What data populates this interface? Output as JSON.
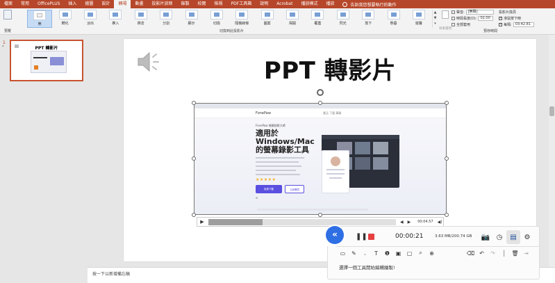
{
  "menu": {
    "tabs": [
      "檔案",
      "常用",
      "OfficePLUS",
      "插入",
      "繪圖",
      "設計",
      "轉場",
      "動畫",
      "投影片放映",
      "錄製",
      "校閱",
      "檢視",
      "PDF工具箱",
      "說明",
      "Acrobat",
      "播放模式",
      "播放"
    ],
    "active_index": 6,
    "tell_me": "告訴我您想要執行的動作"
  },
  "ribbon": {
    "preview_label": "預覽",
    "transitions_group_label": "切換到此投影片",
    "transitions": [
      "無",
      "轉化",
      "淡出",
      "推入",
      "擦去",
      "分割",
      "顯示",
      "切換",
      "隨機線條",
      "圖案",
      "揭開",
      "覆蓋",
      "閃光",
      "落下",
      "懸垂",
      "窗簾",
      "吹動"
    ],
    "selected_transition_index": 0,
    "effect_options_label": "效果選項",
    "timing": {
      "group_label": "預存時間",
      "sound_label": "聲音:",
      "sound_value": "[無聲]",
      "duration_label": "時間長度(D):",
      "duration_value": "02.00",
      "apply_all_label": "全部套用",
      "advance_label": "投影片換頁",
      "on_click_label": "滑鼠按下時",
      "after_label": "每隔:",
      "after_value": "03:42.81"
    }
  },
  "thumbs": {
    "number": "1",
    "star": "*",
    "title": "PPT 轉影片"
  },
  "slide": {
    "title": "PPT 轉影片"
  },
  "video": {
    "site_logo": "FonePaw",
    "site_links": "產品   下載   購買",
    "badge": "FonePaw 螢幕錄影大師",
    "headline_1": "適用於",
    "headline_2": "Windows/Mac",
    "headline_3": "的螢幕錄影工具",
    "stars": "★★★★★",
    "btn_primary": "免費下載",
    "btn_secondary": "立即購買",
    "os_note": "⊞  "
  },
  "video_controls": {
    "play": "▶",
    "progress": 0.29,
    "prev": "◀",
    "next": "▶",
    "time": "00:04.57",
    "volume": "◀)"
  },
  "notes": {
    "placeholder": "按一下以新增備忘稿"
  },
  "recorder": {
    "timer": "00:00:21",
    "size": "3.63 MB/200.74 GB",
    "hint": "選擇一個工具開始編輯繪製!",
    "collapse_icon": "«",
    "pause_icon": "❚❚"
  }
}
